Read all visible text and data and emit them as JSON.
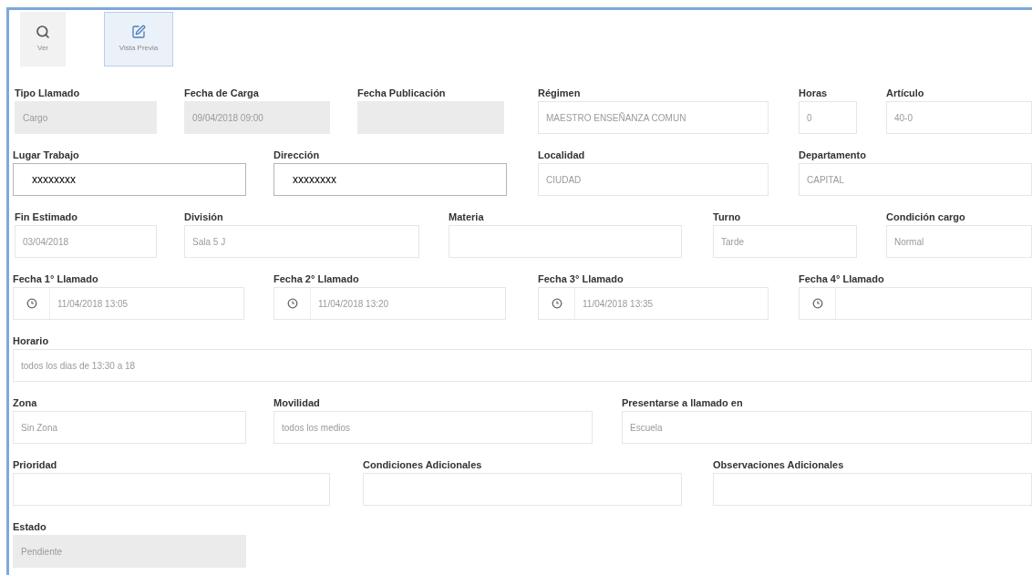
{
  "toolbar": [
    {
      "label": "Ver",
      "selected": false
    },
    {
      "label": "Vista Previa",
      "selected": true
    }
  ],
  "rows": [
    [
      {
        "label": "Tipo Llamado",
        "value": "Cargo",
        "disabled": true,
        "kind": "text"
      },
      {
        "label": "Fecha de Carga",
        "value": "09/04/2018 09:00",
        "disabled": true,
        "kind": "text"
      },
      {
        "label": "Fecha Publicación",
        "disabled": true,
        "kind": "text"
      },
      {
        "label": "Régimen",
        "value": "MAESTRO ENSEÑANZA COMUN",
        "disabled": false,
        "kind": "text"
      },
      {
        "label": "Horas",
        "value": "0",
        "disabled": false,
        "kind": "text"
      },
      {
        "label": "Artículo",
        "value": "40-0",
        "disabled": false,
        "kind": "text"
      }
    ],
    [
      {
        "label": "Lugar Trabajo",
        "value": "xxxxxxxx",
        "disabled": false,
        "kind": "edited"
      },
      {
        "label": "Dirección",
        "value": "xxxxxxxx",
        "disabled": false,
        "kind": "edited"
      },
      {
        "label": "Localidad",
        "value": "CIUDAD",
        "disabled": false,
        "kind": "text"
      },
      {
        "label": "Departamento",
        "value": "CAPITAL",
        "disabled": false,
        "kind": "text"
      }
    ],
    [
      {
        "label": "Fin Estimado",
        "value": "03/04/2018",
        "disabled": false,
        "kind": "text"
      },
      {
        "label": "División",
        "value": "Sala 5 J",
        "disabled": false,
        "kind": "text"
      },
      {
        "label": "Materia",
        "disabled": false,
        "kind": "text"
      },
      {
        "label": "Turno",
        "value": "Tarde",
        "disabled": false,
        "kind": "text"
      },
      {
        "label": "Condición cargo",
        "value": "Normal",
        "disabled": false,
        "kind": "text"
      }
    ],
    [
      {
        "label": "Fecha 1° Llamado",
        "value": "11/04/2018 13:05",
        "disabled": false,
        "kind": "datetime"
      },
      {
        "label": "Fecha 2° Llamado",
        "value": "11/04/2018 13:20",
        "disabled": false,
        "kind": "datetime"
      },
      {
        "label": "Fecha 3° Llamado",
        "value": "11/04/2018 13:35",
        "disabled": false,
        "kind": "datetime"
      },
      {
        "label": "Fecha 4° Llamado",
        "disabled": false,
        "kind": "datetime"
      }
    ],
    [
      {
        "label": "Horario",
        "value": "todos los dias de 13:30 a 18",
        "disabled": false,
        "kind": "text"
      }
    ],
    [
      {
        "label": "Zona",
        "value": "Sin Zona",
        "disabled": false,
        "kind": "text"
      },
      {
        "label": "Movilidad",
        "value": "todos los medios",
        "disabled": false,
        "kind": "text"
      },
      {
        "label": "Presentarse a llamado en",
        "value": "Escuela",
        "disabled": false,
        "kind": "text"
      }
    ],
    [
      {
        "label": "Prioridad",
        "disabled": false,
        "kind": "text"
      },
      {
        "label": "Condiciones Adicionales",
        "disabled": false,
        "kind": "text"
      },
      {
        "label": "Observaciones Adicionales",
        "disabled": false,
        "kind": "text"
      }
    ],
    [
      {
        "label": "Estado",
        "value": "Pendiente",
        "disabled": true,
        "kind": "text"
      }
    ]
  ]
}
